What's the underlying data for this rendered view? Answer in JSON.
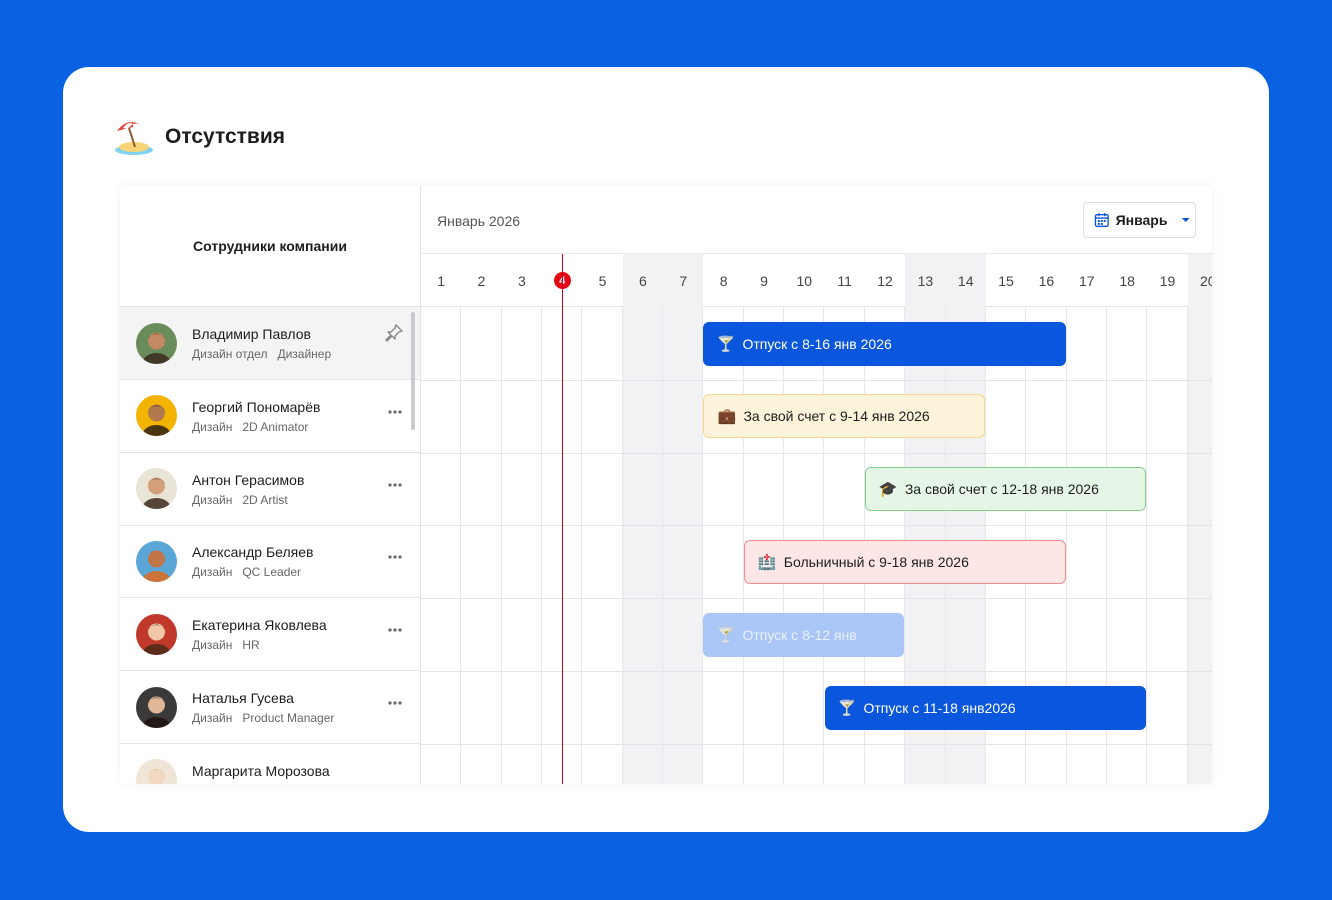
{
  "page": {
    "title": "Отсутствия",
    "title_icon": "beach-umbrella-icon"
  },
  "left_header": "Сотрудники компании",
  "calendar": {
    "month_label": "Январь 2026",
    "month_select": "Январь",
    "today": 4,
    "days": [
      "1",
      "2",
      "3",
      "4",
      "5",
      "6",
      "7",
      "8",
      "9",
      "10",
      "11",
      "12",
      "13",
      "14",
      "15",
      "16",
      "17",
      "18",
      "19",
      "20"
    ],
    "weekend_days": [
      6,
      7,
      13,
      14,
      20
    ]
  },
  "employees": [
    {
      "name": "Владимир Павлов",
      "dept": "Дизайн отдел",
      "role": "Дизайнер",
      "action": "pin-icon",
      "active": true
    },
    {
      "name": "Георгий Пономарёв",
      "dept": "Дизайн",
      "role": "2D Animator",
      "action": "more-icon"
    },
    {
      "name": "Антон Герасимов",
      "dept": "Дизайн",
      "role": "2D Artist",
      "action": "more-icon"
    },
    {
      "name": "Александр Беляев",
      "dept": "Дизайн",
      "role": "QC Leader",
      "action": "more-icon"
    },
    {
      "name": "Екатерина Яковлева",
      "dept": "Дизайн",
      "role": "HR",
      "action": "more-icon"
    },
    {
      "name": "Наталья Гусева",
      "dept": "Дизайн",
      "role": "Product Manager",
      "action": "more-icon"
    },
    {
      "name": "Маргарита Морозова",
      "dept": "",
      "role": "",
      "action": ""
    }
  ],
  "absences": [
    {
      "row": 0,
      "start": 8,
      "end": 16,
      "label": "Отпуск с 8-16 янв 2026",
      "style": "blue",
      "icon": "cocktail-icon"
    },
    {
      "row": 1,
      "start": 8,
      "end": 14,
      "label": "За свой счет с 9-14 янв 2026",
      "style": "yellow",
      "icon": "suitcase-icon"
    },
    {
      "row": 2,
      "start": 12,
      "end": 18,
      "label": "За свой счет с 12-18 янв 2026",
      "style": "green",
      "icon": "graduation-cap-icon"
    },
    {
      "row": 3,
      "start": 9,
      "end": 16,
      "label": "Больничный с 9-18 янв 2026",
      "style": "red",
      "icon": "hospital-icon"
    },
    {
      "row": 4,
      "start": 8,
      "end": 12,
      "label": "Отпуск с 8-12 янв",
      "style": "light",
      "icon": "cocktail-icon"
    },
    {
      "row": 5,
      "start": 11,
      "end": 18,
      "label": "Отпуск с 11-18 янв2026",
      "style": "blue",
      "icon": "cocktail-icon"
    }
  ],
  "colors": {
    "accent": "#0a56dc",
    "background": "#0a62e3",
    "today": "#e30613"
  }
}
